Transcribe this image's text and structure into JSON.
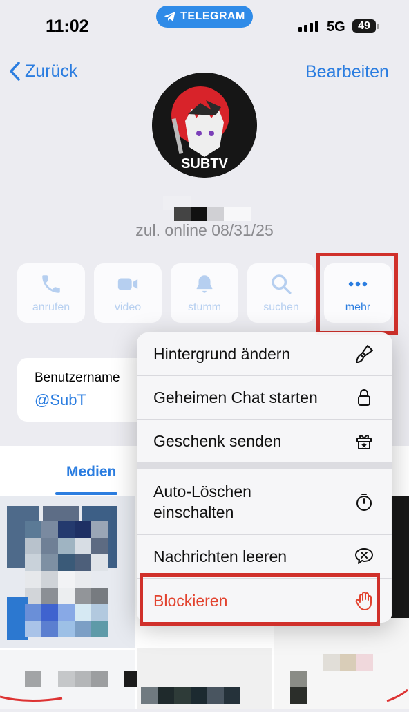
{
  "status_bar": {
    "time": "11:02",
    "app_pill": "TELEGRAM",
    "network": "5G",
    "battery": "49"
  },
  "nav": {
    "back_label": "Zurück",
    "edit_label": "Bearbeiten"
  },
  "profile": {
    "avatar_text": "SUBTV",
    "last_seen": "zul. online 08/31/25"
  },
  "actions": [
    {
      "label": "anrufen",
      "icon": "phone-icon"
    },
    {
      "label": "video",
      "icon": "video-camera-icon"
    },
    {
      "label": "stumm",
      "icon": "bell-icon"
    },
    {
      "label": "suchen",
      "icon": "search-icon"
    },
    {
      "label": "mehr",
      "icon": "more-dots-icon"
    }
  ],
  "username": {
    "label": "Benutzername",
    "value": "@SubT"
  },
  "media": {
    "tab_label": "Medien"
  },
  "menu": {
    "items": [
      {
        "label": "Hintergrund ändern",
        "icon": "paintbrush-icon"
      },
      {
        "label": "Geheimen Chat starten",
        "icon": "lock-icon"
      },
      {
        "label": "Geschenk senden",
        "icon": "gift-icon"
      },
      {
        "label": "Auto-Löschen einschalten",
        "icon": "timer-icon"
      },
      {
        "label": "Nachrichten leeren",
        "icon": "clear-chat-icon"
      },
      {
        "label": "Blockieren",
        "icon": "hand-stop-icon"
      }
    ]
  },
  "colors": {
    "accent": "#2b7de0",
    "danger": "#e2432f",
    "highlight": "#d0302b",
    "background": "#ececf1"
  }
}
